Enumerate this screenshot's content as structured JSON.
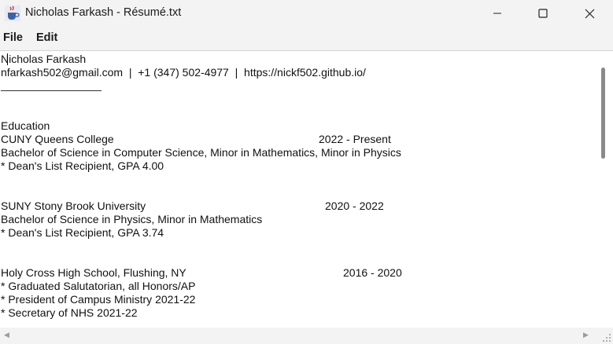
{
  "window": {
    "title": "Nicholas Farkash - Résumé.txt",
    "controls": {
      "minimize": "—",
      "maximize": "☐",
      "close": "✕"
    }
  },
  "menu": {
    "file": "File",
    "edit": "Edit"
  },
  "document": {
    "lines": [
      "Nicholas Farkash",
      "nfarkash502@gmail.com  |  +1 (347) 502-4977  |  https://nickf502.github.io/",
      "Education",
      "CUNY Queens College",
      "2022 - Present",
      "Bachelor of Science in Computer Science, Minor in Mathematics, Minor in Physics",
      "* Dean's List Recipient, GPA 4.00",
      "SUNY Stony Brook University",
      "2020 - 2022",
      "Bachelor of Science in Physics, Minor in Mathematics",
      "* Dean's List Recipient, GPA 3.74",
      "Holy Cross High School, Flushing, NY",
      "2016 - 2020",
      "* Graduated Salutatorian, all Honors/AP",
      "* President of Campus Ministry 2021-22",
      "* Secretary of NHS 2021-22"
    ]
  },
  "colors": {
    "chrome": "#f3f3f3",
    "text": "#111111",
    "scroll_thumb": "#8a8a8a"
  },
  "icons": {
    "app": "java-coffee-icon",
    "resize": "resize-grip-icon"
  }
}
